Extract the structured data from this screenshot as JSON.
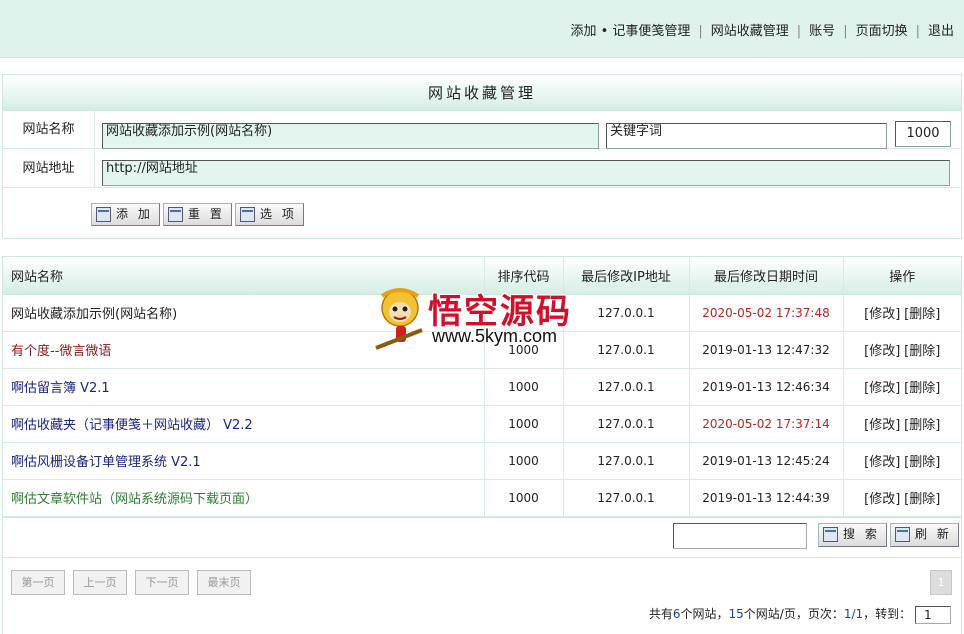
{
  "topnav": {
    "items": [
      "添加 • 记事便笺管理",
      "网站收藏管理",
      "账号",
      "页面切换",
      "退出"
    ]
  },
  "form": {
    "title": "网站收藏管理",
    "name_label": "网站名称",
    "name_value": "网站收藏添加示例(网站名称)",
    "keyword_value": "关键字词",
    "order_value": "1000",
    "url_label": "网站地址",
    "url_value": "http://网站地址",
    "buttons": {
      "add": "添 加",
      "reset": "重 置",
      "options": "选 项"
    }
  },
  "table": {
    "headers": [
      "网站名称",
      "排序代码",
      "最后修改IP地址",
      "最后修改日期时间",
      "操作"
    ],
    "rows": [
      {
        "name": "网站收藏添加示例(网站名称)",
        "order": "",
        "ip": "127.0.0.1",
        "date": "2020-05-02 17:37:48",
        "edit": "[修改]",
        "del": "[删除]"
      },
      {
        "name": "有个度--微言微语",
        "order": "1000",
        "ip": "127.0.0.1",
        "date": "2019-01-13 12:47:32",
        "edit": "[修改]",
        "del": "[删除]"
      },
      {
        "name": "啊估留言簿 V2.1",
        "order": "1000",
        "ip": "127.0.0.1",
        "date": "2019-01-13 12:46:34",
        "edit": "[修改]",
        "del": "[删除]"
      },
      {
        "name": "啊估收藏夹（记事便笺＋网站收藏） V2.2",
        "order": "1000",
        "ip": "127.0.0.1",
        "date": "2020-05-02 17:37:14",
        "edit": "[修改]",
        "del": "[删除]"
      },
      {
        "name": "啊估风栅设备订单管理系统 V2.1",
        "order": "1000",
        "ip": "127.0.0.1",
        "date": "2019-01-13 12:45:24",
        "edit": "[修改]",
        "del": "[删除]"
      },
      {
        "name": "啊估文章软件站（网站系统源码下载页面）",
        "order": "1000",
        "ip": "127.0.0.1",
        "date": "2019-01-13 12:44:39",
        "edit": "[修改]",
        "del": "[删除]"
      }
    ]
  },
  "search": {
    "button": "搜 索",
    "refresh": "刷 新"
  },
  "pager": {
    "first": "第一页",
    "prev": "上一页",
    "next": "下一页",
    "last": "最末页",
    "current_page": "1",
    "info_prefix": "共有",
    "total": "6",
    "info_mid1": "个网站，",
    "per_page": "15",
    "info_mid2": "个网站/页，页次：",
    "page_of": "1/1",
    "info_mid3": "，转到：",
    "jump_value": "1"
  },
  "watermark": {
    "brand": "悟空源码",
    "url": "www.5kym.com"
  },
  "colors": {
    "header_bg": "#dff3ec",
    "red_date": "#b3261e",
    "link_navy": "#1a237e",
    "link_green": "#2e7d32"
  }
}
